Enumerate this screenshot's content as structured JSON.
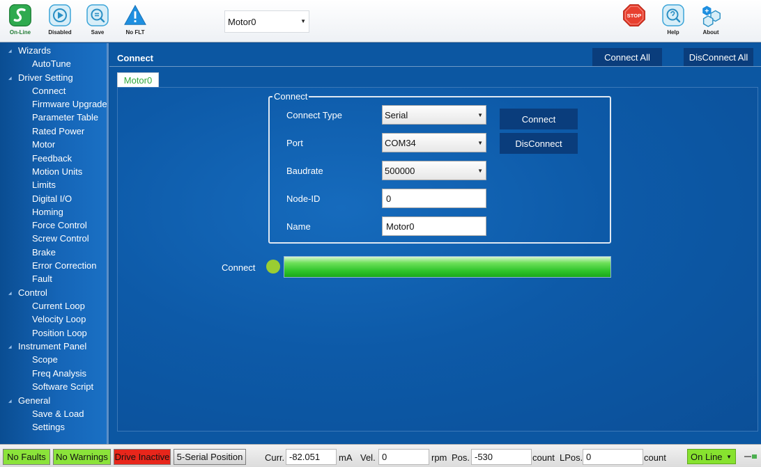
{
  "toolbar": {
    "online_label": "On-Line",
    "disabled_label": "Disabled",
    "save_label": "Save",
    "nofault_label": "No FLT",
    "motor_select": "Motor0",
    "stop_label": "STOP",
    "help_label": "Help",
    "about_label": "About"
  },
  "sidebar": {
    "groups": [
      {
        "label": "Wizards",
        "items": [
          "AutoTune"
        ]
      },
      {
        "label": "Driver Setting",
        "items": [
          "Connect",
          "Firmware Upgrade",
          "Parameter Table",
          "Rated Power",
          "Motor",
          "Feedback",
          "Motion Units",
          "Limits",
          "Digital I/O",
          "Homing",
          "Force Control",
          "Screw Control",
          "Brake",
          "Error Correction",
          "Fault"
        ]
      },
      {
        "label": "Control",
        "items": [
          "Current Loop",
          "Velocity Loop",
          "Position Loop"
        ]
      },
      {
        "label": "Instrument Panel",
        "items": [
          "Scope",
          "Freq Analysis",
          "Software Script"
        ]
      },
      {
        "label": "General",
        "items": [
          "Save & Load",
          "Settings"
        ]
      }
    ]
  },
  "main": {
    "title": "Connect",
    "connect_all": "Connect All",
    "disconnect_all": "DisConnect All",
    "tab": "Motor0",
    "group_title": "Connect",
    "fields": {
      "connect_type_label": "Connect Type",
      "connect_type_value": "Serial",
      "port_label": "Port",
      "port_value": "COM34",
      "baudrate_label": "Baudrate",
      "baudrate_value": "500000",
      "node_id_label": "Node-ID",
      "node_id_value": "0",
      "name_label": "Name",
      "name_value": "Motor0"
    },
    "connect_button": "Connect",
    "disconnect_button": "DisConnect",
    "status_label": "Connect",
    "progress_fraction": 1.0,
    "led_color": "#9acd32"
  },
  "statusbar": {
    "no_faults": "No Faults",
    "no_warnings": "No Warnings",
    "drive_inactive": "Drive Inactive",
    "mode": "5-Serial Position",
    "curr_label": "Curr.",
    "curr_value": "-82.051",
    "curr_unit": "mA",
    "vel_label": "Vel.",
    "vel_value": "0",
    "vel_unit": "rpm",
    "pos_label": "Pos.",
    "pos_value": "-530",
    "pos_unit": "count",
    "lpos_label": "LPos.",
    "lpos_value": "0",
    "lpos_unit": "count",
    "online_state": "On Line"
  },
  "colors": {
    "ok_green": "#8be33a",
    "fault_red": "#e8261b",
    "panel_blue": "#0c57a2",
    "button_navy": "#0a3d7c"
  }
}
